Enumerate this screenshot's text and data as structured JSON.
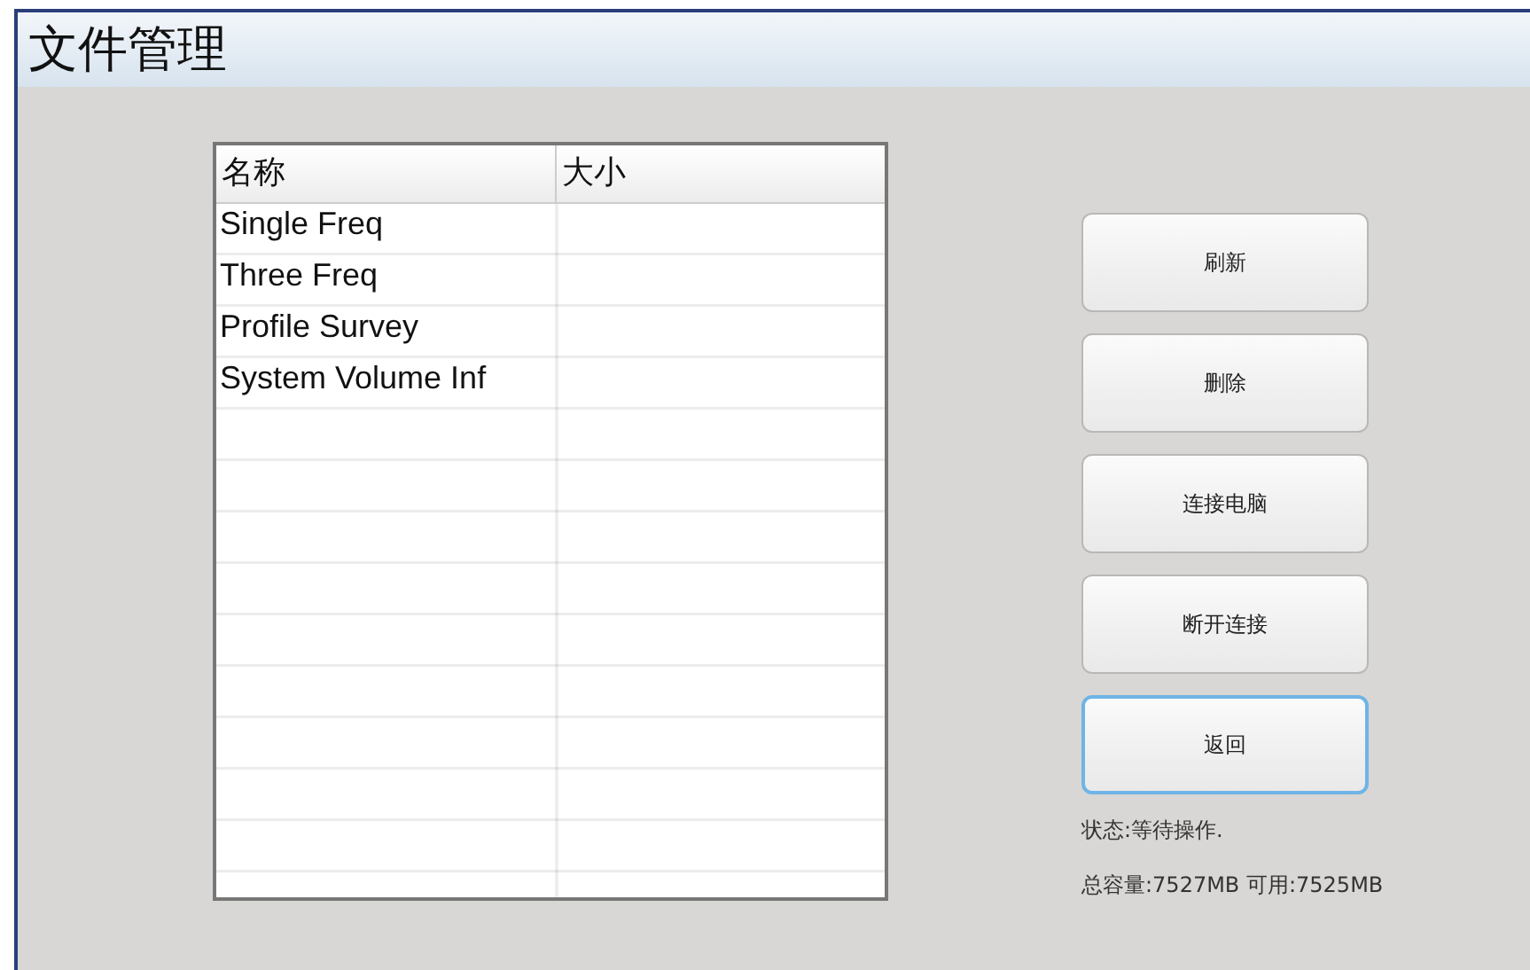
{
  "window": {
    "title": "文件管理"
  },
  "table": {
    "columns": [
      "名称",
      "大小"
    ],
    "rows": [
      {
        "name": "Single Freq"
      },
      {
        "name": "Three Freq"
      },
      {
        "name": "Profile Survey"
      },
      {
        "name": "System Volume Inf"
      }
    ]
  },
  "buttons": [
    {
      "label": "刷新",
      "focused": false
    },
    {
      "label": "删除",
      "focused": false
    },
    {
      "label": "连接电脑",
      "focused": false
    },
    {
      "label": "断开连接",
      "focused": false
    },
    {
      "label": "返回",
      "focused": true
    }
  ],
  "status": {
    "state": "状态:等待操作.",
    "capacity": "总容量:7527MB 可用:7525MB"
  }
}
